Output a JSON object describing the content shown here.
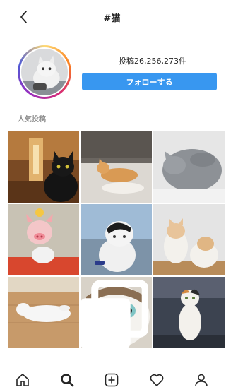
{
  "header": {
    "title": "#猫",
    "back_icon": "chevron-left-icon"
  },
  "profile": {
    "post_count": "投稿26,256,273件",
    "follow_label": "フォローする",
    "accent_color": "#3897f0"
  },
  "section": {
    "label": "人気投稿"
  },
  "grid": {
    "tiles": [
      {
        "subject": "black cat in hallway"
      },
      {
        "subject": "orange cat lying on sofa"
      },
      {
        "subject": "gray cat sleeping"
      },
      {
        "subject": "white cat with pig filter"
      },
      {
        "subject": "white and black cat at the sea"
      },
      {
        "subject": "two orange and white cats"
      },
      {
        "subject": "white cat lying on wooden floor"
      },
      {
        "subject": "close-up of tabby white cat",
        "multi": true
      },
      {
        "subject": "calico cat standing"
      }
    ]
  },
  "bottom_nav": {
    "items": [
      "home-icon",
      "search-icon",
      "add-post-icon",
      "heart-icon",
      "profile-icon"
    ],
    "active": "search-icon"
  }
}
